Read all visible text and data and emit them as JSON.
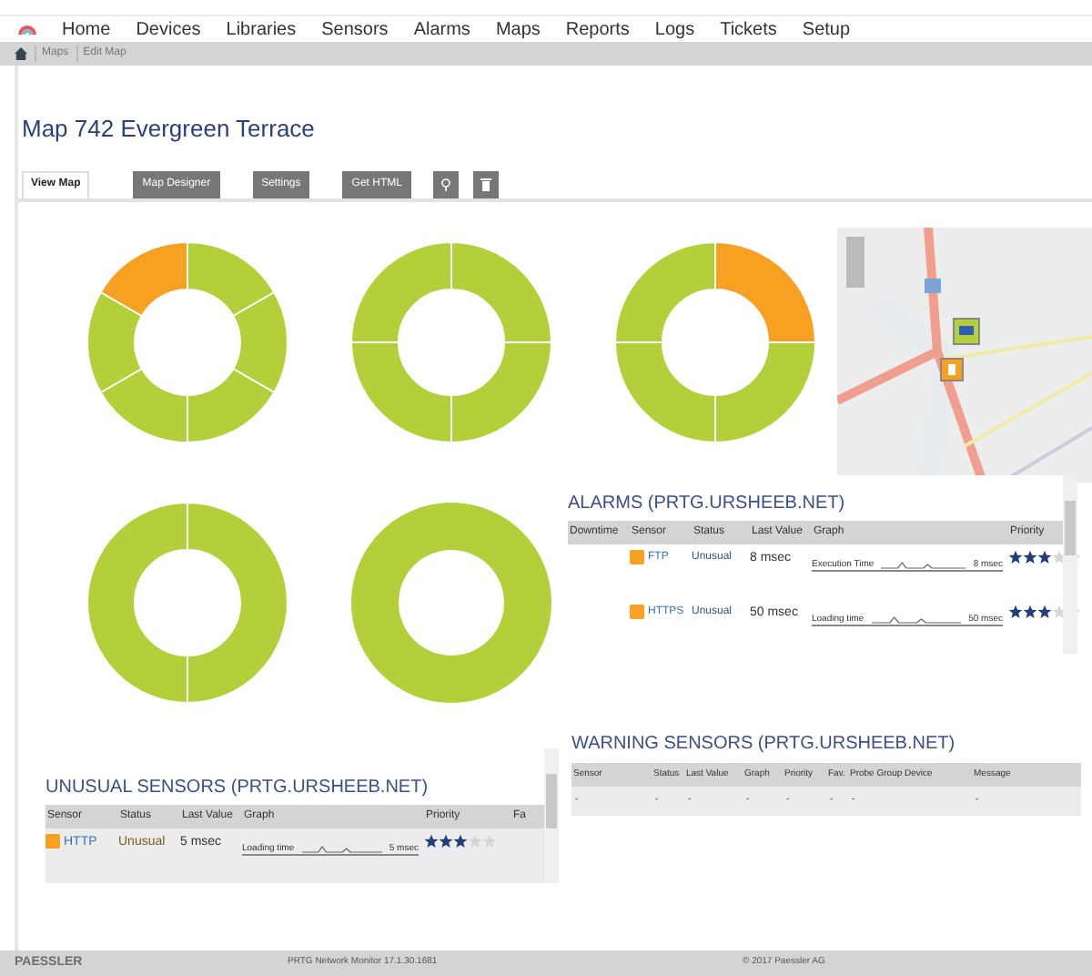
{
  "nav": [
    "Home",
    "Devices",
    "Libraries",
    "Sensors",
    "Alarms",
    "Maps",
    "Reports",
    "Logs",
    "Tickets",
    "Setup"
  ],
  "breadcrumbs": [
    "Maps",
    "Edit Map"
  ],
  "title": "Map 742 Evergreen Terrace",
  "tabs": [
    {
      "label": "View Map",
      "selected": true
    },
    {
      "label": "Map Designer",
      "selected": false
    },
    {
      "label": "Settings",
      "selected": false
    },
    {
      "label": "Get HTML",
      "selected": false
    }
  ],
  "donuts": [
    {
      "segments": [
        {
          "color": "#b3cf3a"
        },
        {
          "color": "#b3cf3a"
        },
        {
          "color": "#b3cf3a"
        },
        {
          "color": "#b3cf3a"
        },
        {
          "color": "#b3cf3a"
        },
        {
          "color": "#f7a021"
        }
      ]
    },
    {
      "segments": [
        {
          "color": "#b3cf3a"
        },
        {
          "color": "#b3cf3a"
        },
        {
          "color": "#b3cf3a"
        },
        {
          "color": "#b3cf3a"
        }
      ]
    },
    {
      "segments": [
        {
          "color": "#f7a021"
        },
        {
          "color": "#b3cf3a"
        },
        {
          "color": "#b3cf3a"
        },
        {
          "color": "#b3cf3a"
        }
      ]
    },
    {
      "segments": [
        {
          "color": "#b3cf3a"
        },
        {
          "color": "#b3cf3a"
        }
      ]
    },
    {
      "segments": [
        {
          "color": "#b3cf3a"
        }
      ]
    }
  ],
  "alarms": {
    "title": "ALARMS (PRTG.URSHEEB.NET)",
    "columns": [
      "Downtime",
      "Sensor",
      "Status",
      "Last Value",
      "Graph",
      "Priority"
    ],
    "rows": [
      {
        "sensor": "FTP",
        "status": "Unusual",
        "last_value": "8 msec",
        "graph_label": "Execution Time",
        "graph_value": "8 msec",
        "stars": 3
      },
      {
        "sensor": "HTTPS",
        "status": "Unusual",
        "last_value": "50 msec",
        "graph_label": "Loading time",
        "graph_value": "50 msec",
        "stars": 3
      }
    ]
  },
  "warning": {
    "title": "WARNING SENSORS (PRTG.URSHEEB.NET)",
    "columns": [
      "Sensor",
      "Status",
      "Last Value",
      "Graph",
      "Priority",
      "Fav.",
      "Probe Group Device",
      "Message"
    ],
    "row": [
      "-",
      "-",
      "-",
      "-",
      "-",
      "-",
      "-",
      "-"
    ]
  },
  "unusual": {
    "title": "UNUSUAL SENSORS (PRTG.URSHEEB.NET)",
    "columns": [
      "Sensor",
      "Status",
      "Last Value",
      "Graph",
      "Priority",
      "Fa"
    ],
    "rows": [
      {
        "sensor": "HTTP",
        "status": "Unusual",
        "last_value": "5 msec",
        "graph_label": "Loading time",
        "graph_value": "5 msec",
        "stars": 3
      }
    ]
  },
  "footer": {
    "logo": "PAESSLER",
    "version": "PRTG Network Monitor 17.1.30.1681",
    "copyright": "© 2017 Paessler AG"
  }
}
